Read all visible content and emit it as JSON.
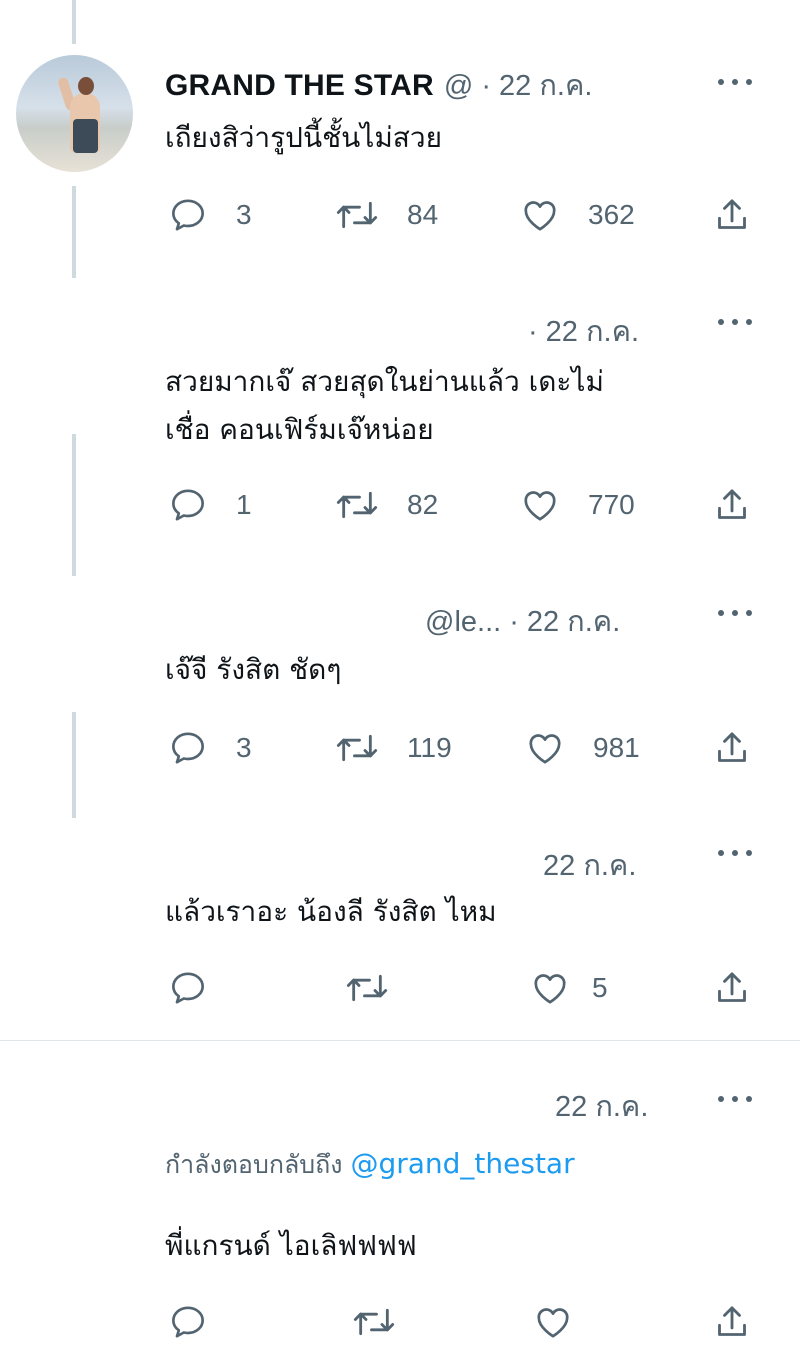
{
  "tweets": [
    {
      "author": "GRAND THE STAR",
      "handle": "@",
      "separator": "·",
      "time": "22 ก.ค.",
      "text": "เถียงสิว่ารูปนี้ชั้นไม่สวย",
      "replies": "3",
      "retweets": "84",
      "likes": "362"
    },
    {
      "separator": "·",
      "time": "22 ก.ค.",
      "text_line1": "สวยมากเจ๊ สวยสุดในย่านแล้ว เดะไม่",
      "text_line2": "เชื่อ คอนเฟิร์มเจ๊หน่อย",
      "replies": "1",
      "retweets": "82",
      "likes": "770"
    },
    {
      "handle": "@le...",
      "separator": "·",
      "time": "22 ก.ค.",
      "text": "เจ๊จี รังสิต ชัดๆ",
      "replies": "3",
      "retweets": "119",
      "likes": "981"
    },
    {
      "time": "22 ก.ค.",
      "text": "แล้วเราอะ น้องลี รังสิต ไหม",
      "replies": "",
      "retweets": "",
      "likes": "5"
    },
    {
      "time": "22 ก.ค.",
      "replying_prefix": "กำลังตอบกลับถึง",
      "replying_mention": "@grand_thestar",
      "text": "พี่แกรนด์ ไอเลิฟฟฟฟ",
      "replies": "",
      "retweets": "",
      "likes": ""
    }
  ],
  "icons": {
    "reply": "reply-icon",
    "retweet": "retweet-icon",
    "like": "heart-icon",
    "share": "share-icon",
    "more": "more-icon"
  },
  "colors": {
    "text": "#0f1419",
    "secondary": "#536471",
    "link": "#1d9bf0",
    "thread_line": "#cfd9de"
  }
}
